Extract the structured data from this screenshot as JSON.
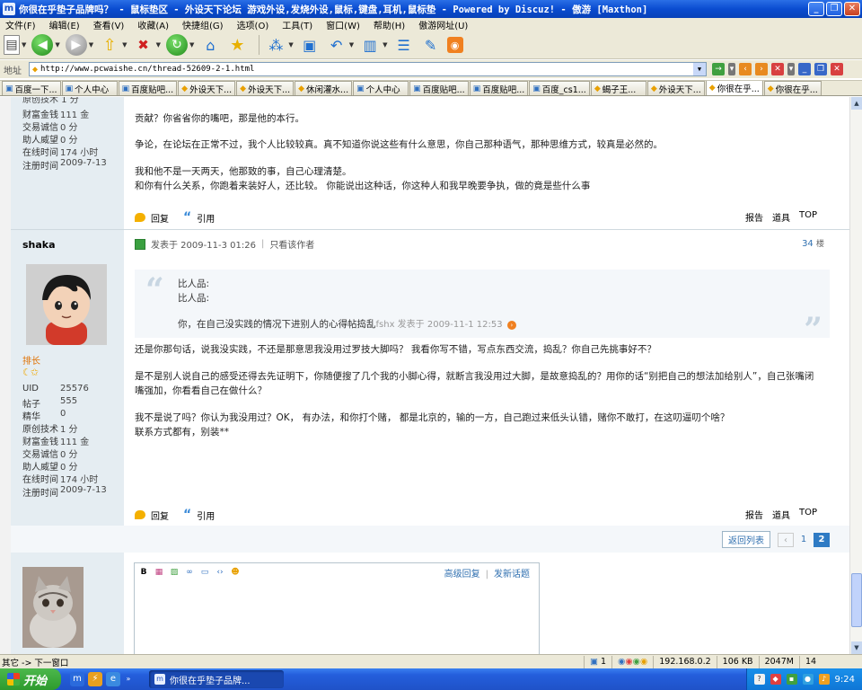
{
  "window": {
    "title": "你很在乎垫子品牌吗？ - 鼠标垫区 - 外设天下论坛 游戏外设,发烧外设,鼠标,键盘,耳机,鼠标垫 - Powered by Discuz! - 傲游 [Maxthon]"
  },
  "menu": [
    "文件(F)",
    "编辑(E)",
    "查看(V)",
    "收藏(A)",
    "快捷组(G)",
    "选项(O)",
    "工具(T)",
    "窗口(W)",
    "帮助(H)",
    "傲游网址(U)"
  ],
  "address": {
    "label": "地址",
    "url": "http://www.pcwaishe.cn/thread-52609-2-1.html"
  },
  "tabs": [
    {
      "label": "百度一下..."
    },
    {
      "label": "个人中心"
    },
    {
      "label": "百度贴吧..."
    },
    {
      "label": "外设天下..."
    },
    {
      "label": "外设天下..."
    },
    {
      "label": "休闲灌水..."
    },
    {
      "label": "个人中心"
    },
    {
      "label": "百度贴吧..."
    },
    {
      "label": "百度贴吧..."
    },
    {
      "label": "百度_cs1..."
    },
    {
      "label": "蝎子王..."
    },
    {
      "label": "外设天下..."
    },
    {
      "label": "你很在乎..."
    },
    {
      "label": "你很在乎..."
    }
  ],
  "post1": {
    "stats_top_cut": "原创技术  1 分",
    "stats": [
      {
        "k": "财富金钱",
        "v": "111 金"
      },
      {
        "k": "交易诚信",
        "v": "0 分"
      },
      {
        "k": "助人威望",
        "v": "0 分"
      },
      {
        "k": "在线时间",
        "v": "174 小时"
      },
      {
        "k": "注册时间",
        "v": "2009-7-13"
      }
    ],
    "lines": [
      "贡献？你省省你的嘴吧，那是他的本行。",
      "争论，在论坛在正常不过，我个人比较较真。真不知道你说这些有什么意思，你自己那种语气，那种思维方式，较真是必然的。",
      "我和他不是一天两天，他那致的事，自己心理清楚。",
      "和你有什么关系，你跑着来装好人，还比较。  你能说出这种话，你这种人和我早晚要争执，做的竟是些什么事"
    ]
  },
  "actions": {
    "reply": "回复",
    "quote": "引用",
    "report": "报告",
    "tools": "道具",
    "top": "TOP"
  },
  "post2": {
    "username": "shaka",
    "rank": "排长",
    "stars": "☾✩",
    "stats": [
      {
        "k": "UID",
        "v": "25576"
      },
      {
        "k": "帖子",
        "v": "555"
      },
      {
        "k": "精华",
        "v": "0"
      },
      {
        "k": "原创技术",
        "v": "1 分"
      },
      {
        "k": "财富金钱",
        "v": "111 金"
      },
      {
        "k": "交易诚信",
        "v": "0 分"
      },
      {
        "k": "助人威望",
        "v": "0 分"
      },
      {
        "k": "在线时间",
        "v": "174 小时"
      },
      {
        "k": "注册时间",
        "v": "2009-7-13"
      }
    ],
    "meta_posted": "发表于 2009-11-3 01:26",
    "meta_author_only": "只看该作者",
    "floor_num": "34",
    "floor_unit": "楼",
    "quote": {
      "l1": "比人品:",
      "l2": "比人品:",
      "l3": "你，在自己没实践的情况下进别人的心得帖捣乱",
      "meta": "fshx 发表于 2009-11-1 12:53"
    },
    "lines": [
      "还是你那句话，说我没实践，不还是那意思我没用过罗技大脚吗？  我看你写不错，写点东西交流，捣乱？你自己先挑事好不？",
      "是不是别人说自己的感受还得去先证明下，你随便搜了几个我的小脚心得，就断言我没用过大脚，是故意捣乱的？用你的话“别把自己的想法加给别人”，自己张嘴闭",
      "嘴强加，你看看自己在做什么？",
      "我不是说了吗？你认为我没用过？OK，  有办法，和你打个赌，  都是北京的，输的一方，自己跑过来低头认错，赌你不敢打，在这叨逼叨个啥？",
      "联系方式都有，别装**"
    ]
  },
  "pager": {
    "back": "返回列表",
    "prev": "‹",
    "pages": [
      "1",
      "2"
    ]
  },
  "editor": {
    "advanced": "高级回复",
    "new_topic": "发新话题"
  },
  "status": {
    "left": "其它 -> 下一窗口",
    "count": "1",
    "ip": "192.168.0.2",
    "size": "106 KB",
    "mem": "2047M",
    "extra": "14"
  },
  "taskbar": {
    "start": "开始",
    "item": "你很在乎垫子品牌...",
    "time": "9:24"
  }
}
